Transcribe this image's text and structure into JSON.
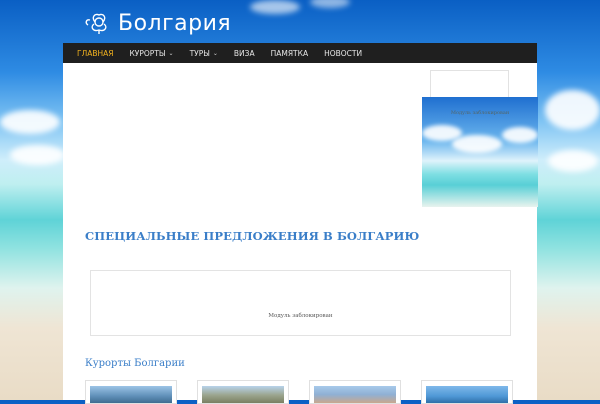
{
  "site": {
    "logo_text": "Болгария",
    "logo_icon": "rose-icon"
  },
  "nav": {
    "items": [
      {
        "label": "ГЛАВНАЯ",
        "active": true,
        "has_dropdown": false
      },
      {
        "label": "КУРОРТЫ",
        "active": false,
        "has_dropdown": true
      },
      {
        "label": "ТУРЫ",
        "active": false,
        "has_dropdown": true
      },
      {
        "label": "ВИЗА",
        "active": false,
        "has_dropdown": false
      },
      {
        "label": "ПАМЯТКА",
        "active": false,
        "has_dropdown": false
      },
      {
        "label": "НОВОСТИ",
        "active": false,
        "has_dropdown": false
      }
    ],
    "active_color": "#f2b21f"
  },
  "sidebar": {
    "photo_ad_label": "Модуль заблокирован"
  },
  "main": {
    "special_offers_title": "СПЕЦИАЛЬНЫЕ ПРЕДЛОЖЕНИЯ В БОЛГАРИЮ",
    "blocked_module_text": "Модуль заблокирован",
    "resorts_title": "Курорты Болгарии"
  },
  "colors": {
    "accent": "#3a7ec8",
    "nav_bg": "#1f1f1f"
  }
}
